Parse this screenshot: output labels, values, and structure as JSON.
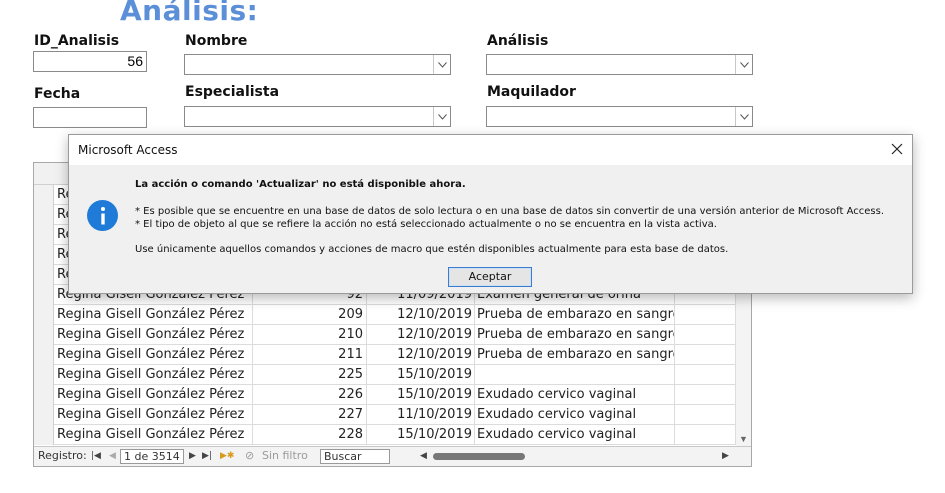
{
  "form": {
    "heading": "Análisis:",
    "fields": {
      "id_label": "ID_Analisis",
      "id_value": "56",
      "nombre_label": "Nombre",
      "analisis_label": "Análisis",
      "fecha_label": "Fecha",
      "especialista_label": "Especialista",
      "maquilador_label": "Maquilador"
    }
  },
  "datasheet": {
    "partial_rows": [
      "Re",
      "Re",
      "Re",
      "Re",
      "Re"
    ],
    "rows": [
      {
        "nombre": "Regina Gisell González Pérez",
        "id": "92",
        "fecha": "11/09/2019",
        "analisis": "Examen general de orina"
      },
      {
        "nombre": "Regina Gisell González Pérez",
        "id": "209",
        "fecha": "12/10/2019",
        "analisis": "Prueba de embarazo en sangre"
      },
      {
        "nombre": "Regina Gisell González Pérez",
        "id": "210",
        "fecha": "12/10/2019",
        "analisis": "Prueba de embarazo en sangre"
      },
      {
        "nombre": "Regina Gisell González Pérez",
        "id": "211",
        "fecha": "12/10/2019",
        "analisis": "Prueba de embarazo en sangre"
      },
      {
        "nombre": "Regina Gisell González Pérez",
        "id": "225",
        "fecha": "15/10/2019",
        "analisis": ""
      },
      {
        "nombre": "Regina Gisell González Pérez",
        "id": "226",
        "fecha": "15/10/2019",
        "analisis": "Exudado cervico vaginal"
      },
      {
        "nombre": "Regina Gisell González Pérez",
        "id": "227",
        "fecha": "11/10/2019",
        "analisis": "Exudado cervico vaginal"
      },
      {
        "nombre": "Regina Gisell González Pérez",
        "id": "228",
        "fecha": "15/10/2019",
        "analisis": "Exudado cervico vaginal"
      }
    ],
    "navbar": {
      "registro_label": "Registro:",
      "record_position": "1 de 3514",
      "filter_label": "Sin filtro",
      "search_label": "Buscar"
    }
  },
  "dialog": {
    "title": "Microsoft Access",
    "heading": "La acción o comando 'Actualizar' no está disponible ahora.",
    "bullet1": "* Es posible que se encuentre en una base de datos de solo lectura o en una base de datos sin convertir de una versión anterior de Microsoft Access.",
    "bullet2": "* El tipo de objeto al que se refiere la acción no está seleccionado actualmente o no se encuentra en la vista activa.",
    "hint": "Use únicamente aquellos comandos y acciones de macro que estén disponibles actualmente para esta base de datos.",
    "ok_label": "Aceptar",
    "icon": "information-icon"
  },
  "colors": {
    "heading": "#5b8fd8",
    "info_icon": "#1f7bd7",
    "ok_border": "#3d7bcf"
  }
}
